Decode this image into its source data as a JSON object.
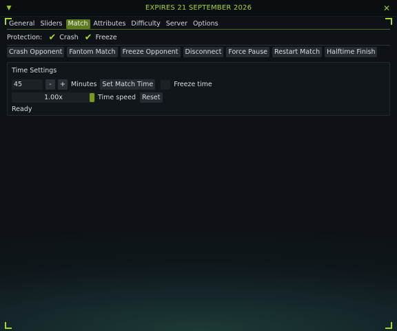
{
  "window": {
    "title": "EXPIRES 21 SEPTEMBER 2026",
    "collapse_icon": "triangle-down-icon",
    "close_icon": "close-icon",
    "accent_color": "#a8d82a"
  },
  "tabs": [
    {
      "label": "General",
      "active": false
    },
    {
      "label": "Sliders",
      "active": false
    },
    {
      "label": "Match",
      "active": true
    },
    {
      "label": "Attributes",
      "active": false
    },
    {
      "label": "Difficulty",
      "active": false
    },
    {
      "label": "Server",
      "active": false
    },
    {
      "label": "Options",
      "active": false
    }
  ],
  "protection": {
    "label": "Protection:",
    "options": [
      {
        "label": "Crash",
        "checked": true
      },
      {
        "label": "Freeze",
        "checked": true
      }
    ]
  },
  "actions": [
    "Crash Opponent",
    "Fantom Match",
    "Freeze Opponent",
    "Disconnect",
    "Force Pause",
    "Restart Match",
    "Halftime Finish"
  ],
  "time_settings": {
    "title": "Time Settings",
    "minutes_value": "45",
    "minus_label": "-",
    "plus_label": "+",
    "minutes_label": "Minutes",
    "set_button": "Set Match Time",
    "freeze_time_label": "Freeze time",
    "freeze_time_checked": false,
    "speed_value": "1.00x",
    "speed_fraction": 1.0,
    "speed_label": "Time speed",
    "reset_button": "Reset",
    "status": "Ready"
  }
}
